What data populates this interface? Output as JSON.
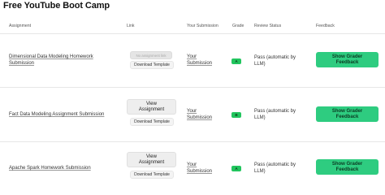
{
  "page": {
    "title": "Free YouTube Boot Camp"
  },
  "table": {
    "headers": {
      "assignment": "Assignment",
      "link": "Link",
      "submission": "Your Submission",
      "grade": "Grade",
      "status": "Review Status",
      "feedback": "Feedback"
    },
    "rows": [
      {
        "assignment": "Dimensional Data Modeling Homework Submission",
        "link_button": "No assignment link",
        "download": "Download Template",
        "submission_line1": "Your",
        "submission_line2": "Submission",
        "grade": "A",
        "status_line1": "Pass (automatic by",
        "status_line2": "LLM)",
        "feedback_line1": "Show Grader",
        "feedback_line2": "Feedback"
      },
      {
        "assignment": "Fact Data Modeling Assignment Submission",
        "link_button_line1": "View",
        "link_button_line2": "Assignment",
        "download": "Download Template",
        "submission_line1": "Your",
        "submission_line2": "Submission",
        "grade": "B",
        "status_line1": "Pass (automatic by",
        "status_line2": "LLM)",
        "feedback_line1": "Show Grader",
        "feedback_line2": "Feedback"
      },
      {
        "assignment": "Apache Spark Homework Submission",
        "link_button_line1": "View",
        "link_button_line2": "Assignment",
        "download": "Download Template",
        "submission_line1": "Your",
        "submission_line2": "Submission",
        "grade": "A",
        "status_line1": "Pass (automatic by",
        "status_line2": "LLM)",
        "feedback_line1": "Show Grader",
        "feedback_line2": "Feedback"
      }
    ]
  },
  "colors": {
    "grade_badge": "#22c55e",
    "feedback_button": "#2ecc80"
  }
}
